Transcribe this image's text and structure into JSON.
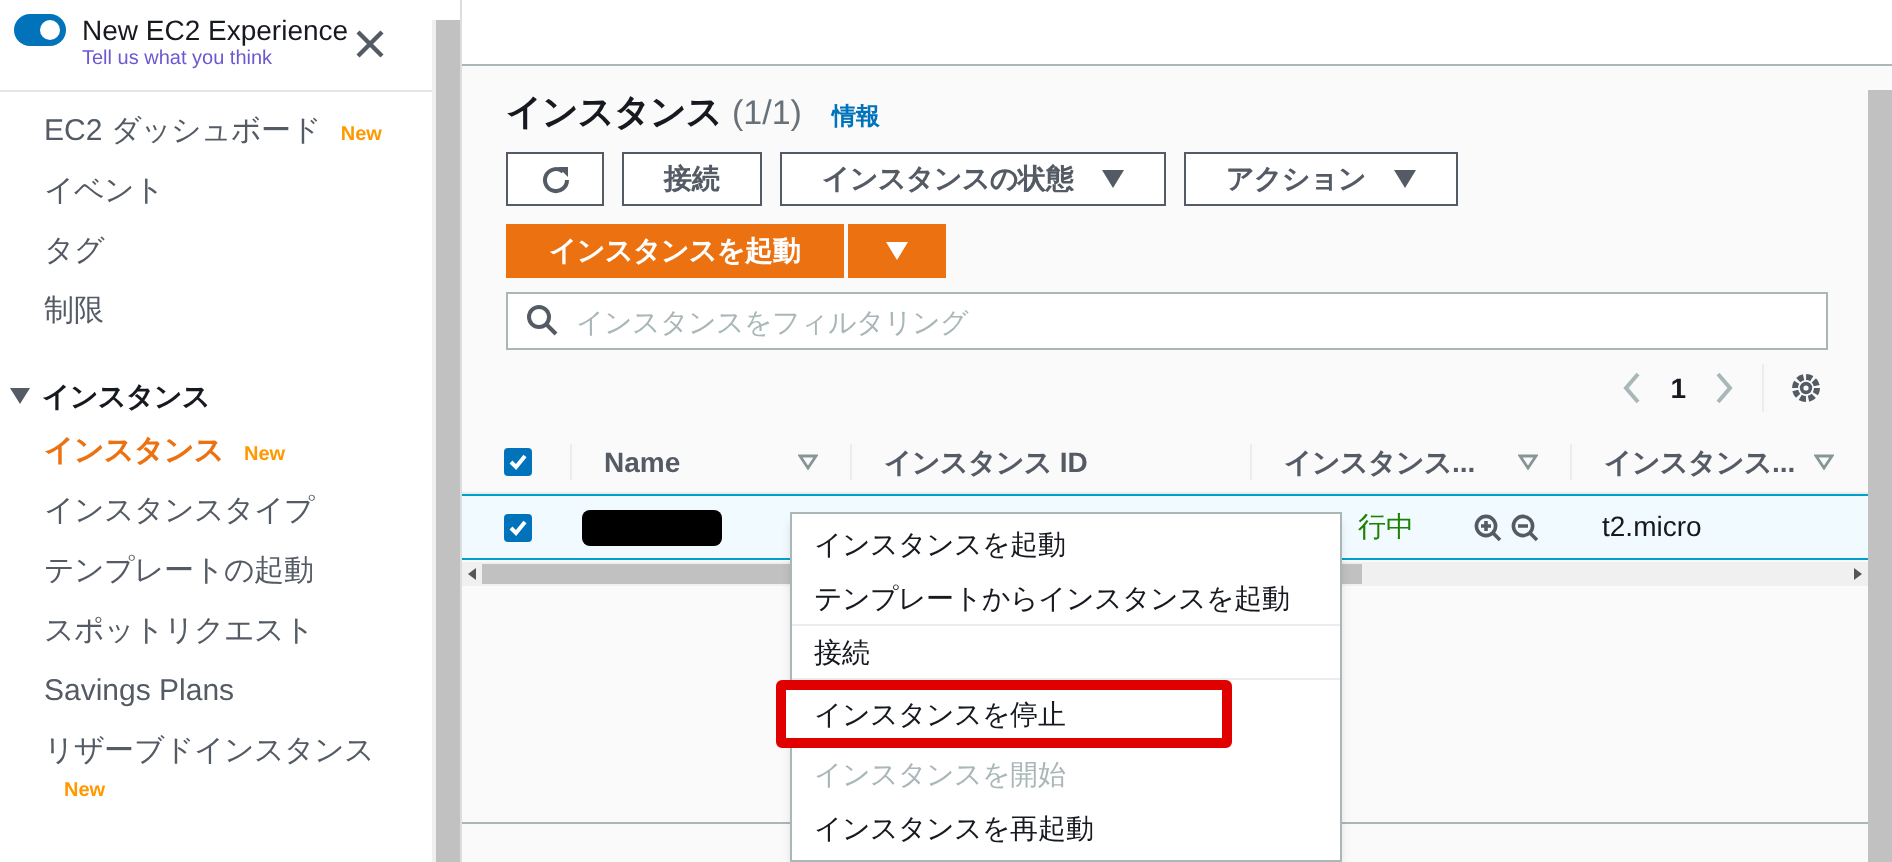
{
  "banner": {
    "title": "New EC2 Experience",
    "link": "Tell us what you think",
    "toggle_on": true
  },
  "sidebar": {
    "items": [
      {
        "label": "EC2 ダッシュボード",
        "badge": "New",
        "selected": false
      },
      {
        "label": "イベント",
        "selected": false
      },
      {
        "label": "タグ",
        "selected": false
      },
      {
        "label": "制限",
        "selected": false
      }
    ],
    "section": {
      "label": "インスタンス",
      "expanded": true,
      "items": [
        {
          "label": "インスタンス",
          "badge": "New",
          "selected": true
        },
        {
          "label": "インスタンスタイプ",
          "selected": false
        },
        {
          "label": "テンプレートの起動",
          "selected": false
        },
        {
          "label": "スポットリクエスト",
          "selected": false
        },
        {
          "label": "Savings Plans",
          "selected": false
        },
        {
          "label": "リザーブドインスタンス",
          "badge": "New",
          "selected": false
        }
      ]
    }
  },
  "panel": {
    "title": "インスタンス",
    "count": "(1/1)",
    "info": "情報",
    "buttons": [
      {
        "kind": "refresh"
      },
      {
        "kind": "text",
        "label": "接続"
      },
      {
        "kind": "dropdown",
        "label": "インスタンスの状態"
      },
      {
        "kind": "dropdown",
        "label": "アクション"
      }
    ],
    "launch_button": "インスタンスを起動",
    "search": {
      "placeholder": "インスタンスをフィルタリング"
    },
    "page": "1"
  },
  "table": {
    "all_checked": true,
    "columns": [
      "Name",
      "インスタンス ID",
      "インスタンス...",
      "インスタンス..."
    ],
    "rows": [
      {
        "checked": true,
        "name_redacted": true,
        "status": "行中",
        "type": "t2.micro"
      }
    ]
  },
  "context_menu": [
    {
      "label": "インスタンスを起動",
      "disabled": false,
      "highlighted": false,
      "divider_after": false
    },
    {
      "label": "テンプレートからインスタンスを起動",
      "disabled": false,
      "highlighted": false,
      "divider_after": true
    },
    {
      "label": "接続",
      "disabled": false,
      "highlighted": false,
      "divider_after": true
    },
    {
      "label": "インスタンスを停止",
      "disabled": false,
      "highlighted": true,
      "divider_after": false
    },
    {
      "label": "インスタンスを開始",
      "disabled": true,
      "highlighted": false,
      "divider_after": false
    },
    {
      "label": "インスタンスを再起動",
      "disabled": false,
      "highlighted": false,
      "divider_after": false
    }
  ]
}
